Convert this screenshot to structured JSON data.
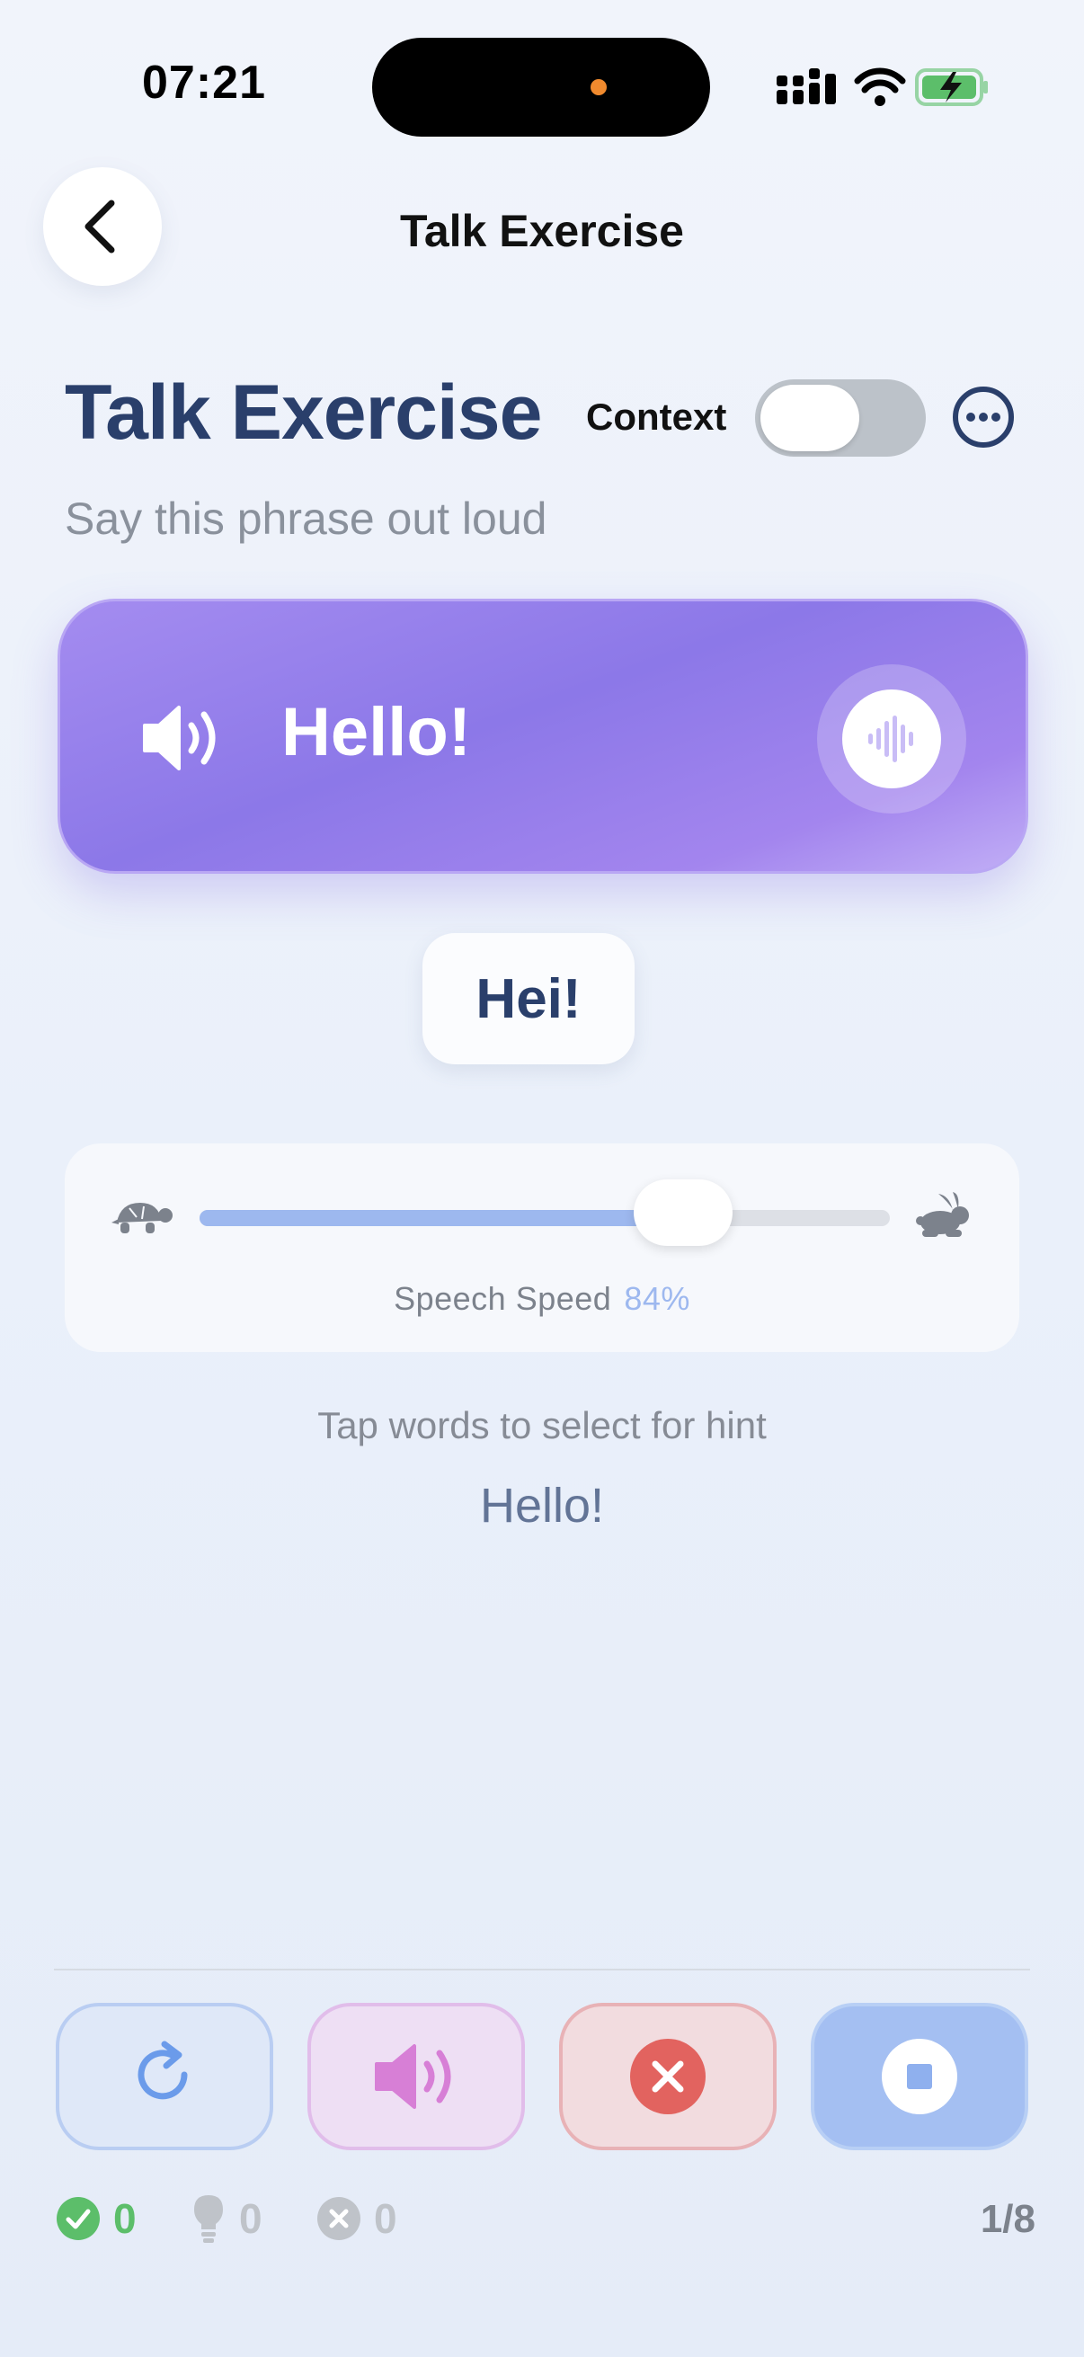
{
  "status_bar": {
    "time": "07:21"
  },
  "nav": {
    "title": "Talk Exercise",
    "back_icon": "chevron-left-icon"
  },
  "header": {
    "title": "Talk Exercise",
    "context_label": "Context",
    "context_toggle_on": false,
    "more_icon": "ellipsis-circle-icon",
    "subtitle": "Say this phrase out loud"
  },
  "phrase_card": {
    "phrase": "Hello!",
    "speaker_icon": "speaker-wave-icon",
    "voice_icon": "waveform-icon"
  },
  "translation": {
    "text": "Hei!"
  },
  "speed": {
    "label": "Speech Speed",
    "value_text": "84%",
    "value": 0.84,
    "slow_icon": "turtle-icon",
    "fast_icon": "rabbit-icon"
  },
  "hint": {
    "instruction": "Tap words to select for hint",
    "words": "Hello!"
  },
  "actions": [
    {
      "name": "retry",
      "icon": "retry-icon"
    },
    {
      "name": "play",
      "icon": "speaker-icon"
    },
    {
      "name": "skip",
      "icon": "close-circle-icon"
    },
    {
      "name": "stop",
      "icon": "stop-icon"
    }
  ],
  "stats": {
    "correct": "0",
    "hints": "0",
    "wrong": "0",
    "progress": "1/8"
  },
  "colors": {
    "title": "#2a3f6b",
    "card_purple": "#8c78e8",
    "slider_fill": "#9db8ef",
    "correct_green": "#5cbe6a",
    "skip_red": "#e2635f",
    "play_pink": "#d77fd6"
  }
}
